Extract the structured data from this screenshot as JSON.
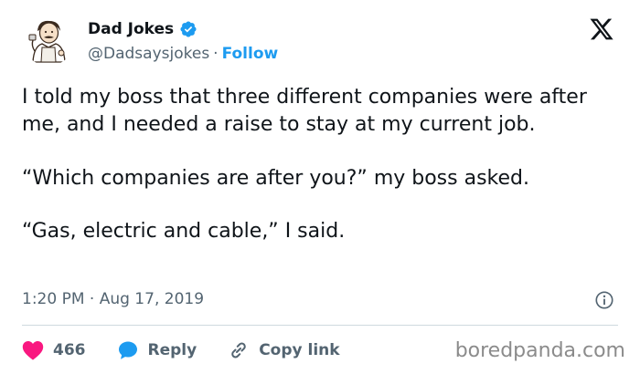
{
  "author": {
    "display_name": "Dad Jokes",
    "handle": "@Dadsaysjokes",
    "separator": "·",
    "follow_label": "Follow",
    "avatar_icon": "cartoon-dad-avatar",
    "verified_icon": "verified-badge-icon",
    "verified_color": "#1d9bf0"
  },
  "platform": {
    "logo_icon": "x-logo-icon"
  },
  "tweet": {
    "paragraphs": [
      "I told my boss that three different companies were after me, and I needed a raise to stay at my current job.",
      "“Which companies are after you?” my boss asked.",
      "“Gas, electric and cable,” I said."
    ],
    "timestamp": "1:20 PM · Aug 17, 2019",
    "info_icon": "info-icon"
  },
  "actions": {
    "like": {
      "icon": "heart-icon",
      "count": "466",
      "color": "#f91880"
    },
    "reply": {
      "icon": "reply-bubble-icon",
      "label": "Reply",
      "color": "#1d9bf0"
    },
    "copy_link": {
      "icon": "link-icon",
      "label": "Copy link"
    }
  },
  "watermark": {
    "text": "boredpanda.com"
  },
  "colors": {
    "text": "#0f1419",
    "secondary": "#536471",
    "accent": "#1d9bf0",
    "divider": "#cfd9de"
  }
}
